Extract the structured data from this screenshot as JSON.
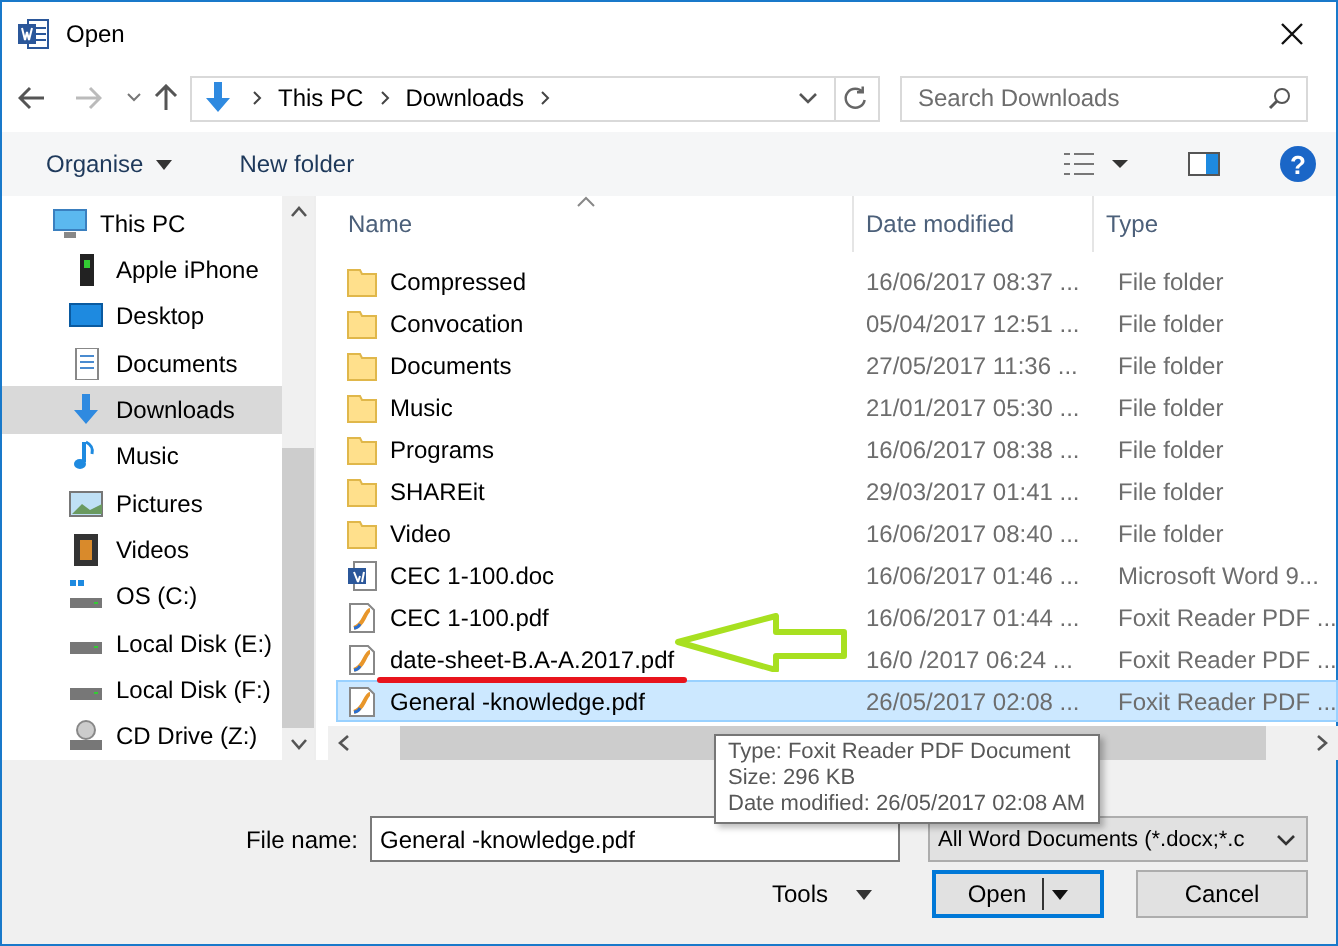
{
  "window": {
    "title": "Open"
  },
  "nav": {
    "path": [
      "This PC",
      "Downloads"
    ],
    "search": {
      "placeholder": "Search Downloads"
    }
  },
  "toolbar": {
    "organise": "Organise",
    "new_folder": "New folder",
    "help": "?"
  },
  "sidebar": {
    "items": [
      {
        "label": "This PC",
        "kind": "pc",
        "selected": false,
        "children": [
          {
            "label": "Apple iPhone",
            "kind": "phone",
            "selected": false
          },
          {
            "label": "Desktop",
            "kind": "desktop",
            "selected": false
          },
          {
            "label": "Documents",
            "kind": "documents",
            "selected": false
          },
          {
            "label": "Downloads",
            "kind": "downloads",
            "selected": true
          },
          {
            "label": "Music",
            "kind": "music",
            "selected": false
          },
          {
            "label": "Pictures",
            "kind": "pictures",
            "selected": false
          },
          {
            "label": "Videos",
            "kind": "videos",
            "selected": false
          },
          {
            "label": "OS (C:)",
            "kind": "os-drive",
            "selected": false
          },
          {
            "label": "Local Disk (E:)",
            "kind": "drive",
            "selected": false
          },
          {
            "label": "Local Disk (F:)",
            "kind": "drive",
            "selected": false
          },
          {
            "label": "CD Drive (Z:)",
            "kind": "cd",
            "selected": false
          }
        ]
      }
    ]
  },
  "table": {
    "columns": [
      "Name",
      "Date modified",
      "Type"
    ],
    "rows": [
      {
        "name": "Compressed",
        "date": "16/06/2017 08:37 ...",
        "type": "File folder",
        "kind": "folder",
        "selected": false
      },
      {
        "name": "Convocation",
        "date": "05/04/2017 12:51 ...",
        "type": "File folder",
        "kind": "folder",
        "selected": false
      },
      {
        "name": "Documents",
        "date": "27/05/2017 11:36 ...",
        "type": "File folder",
        "kind": "folder",
        "selected": false
      },
      {
        "name": "Music",
        "date": "21/01/2017 05:30 ...",
        "type": "File folder",
        "kind": "folder",
        "selected": false
      },
      {
        "name": "Programs",
        "date": "16/06/2017 08:38 ...",
        "type": "File folder",
        "kind": "folder",
        "selected": false
      },
      {
        "name": "SHAREit",
        "date": "29/03/2017 01:41 ...",
        "type": "File folder",
        "kind": "folder",
        "selected": false
      },
      {
        "name": "Video",
        "date": "16/06/2017 08:40 ...",
        "type": "File folder",
        "kind": "folder",
        "selected": false
      },
      {
        "name": "CEC 1-100.doc",
        "date": "16/06/2017 01:46 ...",
        "type": "Microsoft Word 9...",
        "kind": "word",
        "selected": false
      },
      {
        "name": "CEC 1-100.pdf",
        "date": "16/06/2017 01:44 ...",
        "type": "Foxit Reader PDF ...",
        "kind": "pdf",
        "selected": false
      },
      {
        "name": "date-sheet-B.A-A.2017.pdf",
        "date": "16/0 /2017 06:24 ...",
        "type": "Foxit Reader PDF ...",
        "kind": "pdf",
        "selected": false
      },
      {
        "name": "General -knowledge.pdf",
        "date": "26/05/2017 02:08 ...",
        "type": "Foxit Reader PDF ...",
        "kind": "pdf",
        "selected": true
      }
    ]
  },
  "tooltip": [
    "Type: Foxit Reader PDF Document",
    "Size: 296 KB",
    "Date modified: 26/05/2017 02:08 AM"
  ],
  "footer": {
    "file_name_label": "File name:",
    "file_name": "General -knowledge.pdf",
    "filter": "All Word Documents (*.docx;*.c",
    "tools": "Tools",
    "open": "Open",
    "cancel": "Cancel"
  }
}
